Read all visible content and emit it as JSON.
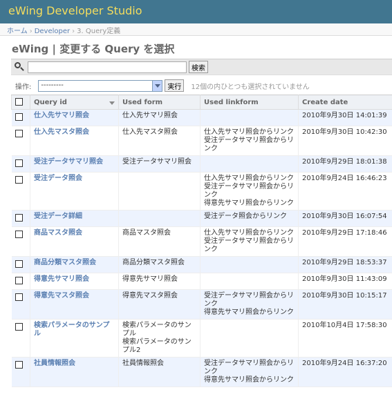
{
  "header": {
    "title": "eWing Developer Studio"
  },
  "breadcrumbs": {
    "home": "ホーム",
    "app": "Developer",
    "current": "3. Query定義"
  },
  "page": {
    "title": "eWing | 変更する Query を選択"
  },
  "search": {
    "value": "",
    "button": "検索"
  },
  "actions": {
    "label": "操作:",
    "selected": "---------",
    "run": "実行",
    "counter": "12個の内ひとつも選択されていません"
  },
  "columns": [
    "Query id",
    "Used form",
    "Used linkform",
    "Create date"
  ],
  "rows": [
    {
      "id": "仕入先サマリ照会",
      "form": [
        "仕入先サマリ照会"
      ],
      "link": [],
      "date": "2010年9月30日 14:01:39"
    },
    {
      "id": "仕入先マスタ照会",
      "form": [
        "仕入先マスタ照会"
      ],
      "link": [
        "仕入先サマリ照会からリンク",
        "受注データサマリ照会からリンク"
      ],
      "date": "2010年9月30日 10:42:30"
    },
    {
      "id": "受注データサマリ照会",
      "form": [
        "受注データサマリ照会"
      ],
      "link": [],
      "date": "2010年9月29日 18:01:38"
    },
    {
      "id": "受注データ照会",
      "form": [],
      "link": [
        "仕入先サマリ照会からリンク",
        "受注データサマリ照会からリンク",
        "得意先サマリ照会からリンク"
      ],
      "date": "2010年9月24日 16:46:23"
    },
    {
      "id": "受注データ詳細",
      "form": [],
      "link": [
        "受注データ照会からリンク"
      ],
      "date": "2010年9月30日 16:07:54"
    },
    {
      "id": "商品マスタ照会",
      "form": [
        "商品マスタ照会"
      ],
      "link": [
        "仕入先サマリ照会からリンク",
        "受注データサマリ照会からリンク"
      ],
      "date": "2010年9月29日 17:18:46"
    },
    {
      "id": "商品分類マスタ照会",
      "form": [
        "商品分類マスタ照会"
      ],
      "link": [],
      "date": "2010年9月29日 18:53:37"
    },
    {
      "id": "得意先サマリ照会",
      "form": [
        "得意先サマリ照会"
      ],
      "link": [],
      "date": "2010年9月30日 11:43:09"
    },
    {
      "id": "得意先マスタ照会",
      "form": [
        "得意先マスタ照会"
      ],
      "link": [
        "受注データサマリ照会からリンク",
        "得意先サマリ照会からリンク"
      ],
      "date": "2010年9月30日 10:15:17"
    },
    {
      "id": "検索パラメータのサンプル",
      "form": [
        "検索パラメータのサンプル",
        "検索パラメータのサンプル2"
      ],
      "link": [],
      "date": "2010年10月4日 17:58:30"
    },
    {
      "id": "社員情報照会",
      "form": [
        "社員情報照会"
      ],
      "link": [
        "受注データサマリ照会からリンク",
        "得意先サマリ照会からリンク"
      ],
      "date": "2010年9月24日 16:37:20"
    }
  ]
}
